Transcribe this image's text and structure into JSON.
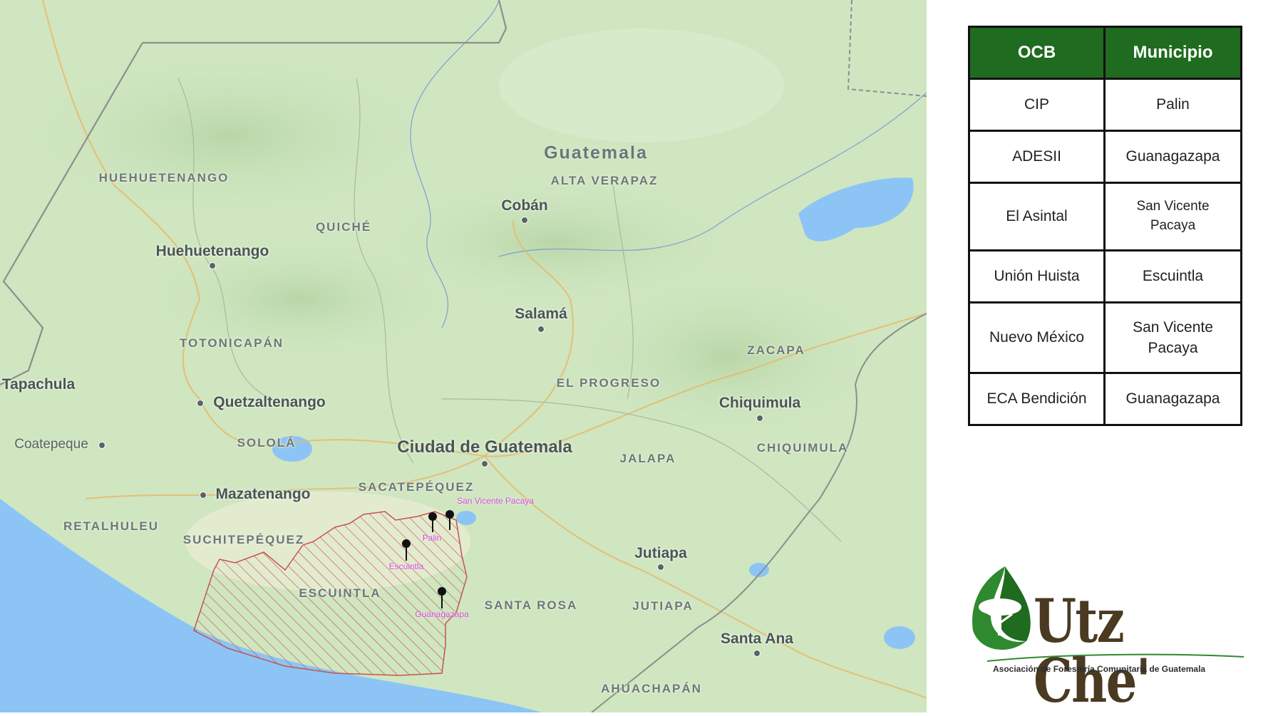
{
  "map": {
    "country_label": "Guatemala",
    "departments": [
      "HUEHUETENANGO",
      "QUICHÉ",
      "ALTA VERAPAZ",
      "TOTONICAPÁN",
      "SOLOLÁ",
      "SACATEPÉQUEZ",
      "RETALHULEU",
      "SUCHITEPÉQUEZ",
      "ESCUINTLA",
      "EL PROGRESO",
      "ZACAPA",
      "JALAPA",
      "CHIQUIMULA",
      "SANTA ROSA",
      "JUTIAPA",
      "AHUACHAPÁN"
    ],
    "cities": [
      "Cobán",
      "Huehuetenango",
      "Salamá",
      "Tapachula",
      "Quetzaltenango",
      "Ciudad de Guatemala",
      "Chiquimula",
      "Coatepeque",
      "Mazatenango",
      "Jutiapa",
      "Santa Ana"
    ],
    "markers": [
      "San Vicente Pacaya",
      "Palin",
      "Escuintla",
      "Guanagazapa"
    ],
    "colors": {
      "land": "#cfe6c0",
      "water": "#8cc4f5",
      "hatch": "#c7534f",
      "pin": "#111111",
      "marker_label": "#d24bd6"
    }
  },
  "table": {
    "headers": [
      "OCB",
      "Municipio"
    ],
    "rows": [
      {
        "ocb": "CIP",
        "municipio": "Palin"
      },
      {
        "ocb": "ADESII",
        "municipio": "Guanagazapa"
      },
      {
        "ocb": "El Asintal",
        "municipio": "San Vicente Pacaya"
      },
      {
        "ocb": "Unión Huista",
        "municipio": "Escuintla"
      },
      {
        "ocb": "Nuevo México",
        "municipio": "San Vicente Pacaya"
      },
      {
        "ocb": "ECA Bendición",
        "municipio": "Guanagazapa"
      }
    ],
    "header_color": "#1f6b1f"
  },
  "logo": {
    "name": "Utz Che'",
    "tagline": "Asociación de Forestería Comunitaria de Guatemala",
    "icon": "tree-leaf-icon"
  }
}
